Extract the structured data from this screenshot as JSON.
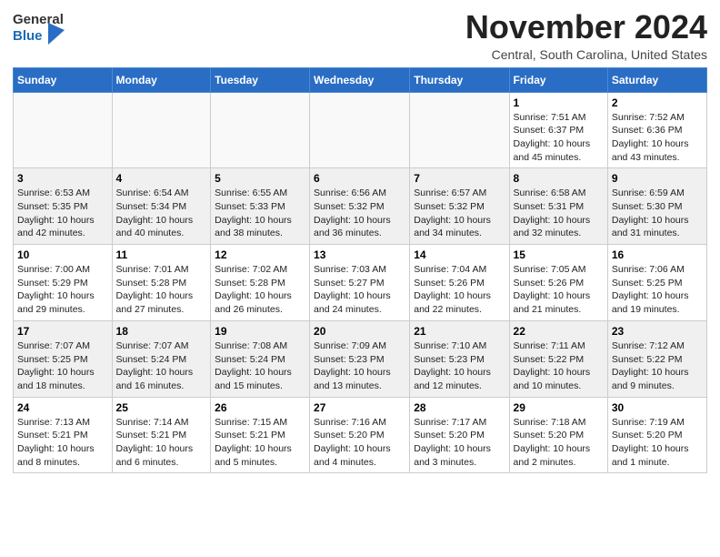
{
  "header": {
    "logo_general": "General",
    "logo_blue": "Blue",
    "month": "November 2024",
    "location": "Central, South Carolina, United States"
  },
  "calendar": {
    "days_of_week": [
      "Sunday",
      "Monday",
      "Tuesday",
      "Wednesday",
      "Thursday",
      "Friday",
      "Saturday"
    ],
    "weeks": [
      [
        {
          "day": "",
          "info": ""
        },
        {
          "day": "",
          "info": ""
        },
        {
          "day": "",
          "info": ""
        },
        {
          "day": "",
          "info": ""
        },
        {
          "day": "",
          "info": ""
        },
        {
          "day": "1",
          "info": "Sunrise: 7:51 AM\nSunset: 6:37 PM\nDaylight: 10 hours\nand 45 minutes."
        },
        {
          "day": "2",
          "info": "Sunrise: 7:52 AM\nSunset: 6:36 PM\nDaylight: 10 hours\nand 43 minutes."
        }
      ],
      [
        {
          "day": "3",
          "info": "Sunrise: 6:53 AM\nSunset: 5:35 PM\nDaylight: 10 hours\nand 42 minutes."
        },
        {
          "day": "4",
          "info": "Sunrise: 6:54 AM\nSunset: 5:34 PM\nDaylight: 10 hours\nand 40 minutes."
        },
        {
          "day": "5",
          "info": "Sunrise: 6:55 AM\nSunset: 5:33 PM\nDaylight: 10 hours\nand 38 minutes."
        },
        {
          "day": "6",
          "info": "Sunrise: 6:56 AM\nSunset: 5:32 PM\nDaylight: 10 hours\nand 36 minutes."
        },
        {
          "day": "7",
          "info": "Sunrise: 6:57 AM\nSunset: 5:32 PM\nDaylight: 10 hours\nand 34 minutes."
        },
        {
          "day": "8",
          "info": "Sunrise: 6:58 AM\nSunset: 5:31 PM\nDaylight: 10 hours\nand 32 minutes."
        },
        {
          "day": "9",
          "info": "Sunrise: 6:59 AM\nSunset: 5:30 PM\nDaylight: 10 hours\nand 31 minutes."
        }
      ],
      [
        {
          "day": "10",
          "info": "Sunrise: 7:00 AM\nSunset: 5:29 PM\nDaylight: 10 hours\nand 29 minutes."
        },
        {
          "day": "11",
          "info": "Sunrise: 7:01 AM\nSunset: 5:28 PM\nDaylight: 10 hours\nand 27 minutes."
        },
        {
          "day": "12",
          "info": "Sunrise: 7:02 AM\nSunset: 5:28 PM\nDaylight: 10 hours\nand 26 minutes."
        },
        {
          "day": "13",
          "info": "Sunrise: 7:03 AM\nSunset: 5:27 PM\nDaylight: 10 hours\nand 24 minutes."
        },
        {
          "day": "14",
          "info": "Sunrise: 7:04 AM\nSunset: 5:26 PM\nDaylight: 10 hours\nand 22 minutes."
        },
        {
          "day": "15",
          "info": "Sunrise: 7:05 AM\nSunset: 5:26 PM\nDaylight: 10 hours\nand 21 minutes."
        },
        {
          "day": "16",
          "info": "Sunrise: 7:06 AM\nSunset: 5:25 PM\nDaylight: 10 hours\nand 19 minutes."
        }
      ],
      [
        {
          "day": "17",
          "info": "Sunrise: 7:07 AM\nSunset: 5:25 PM\nDaylight: 10 hours\nand 18 minutes."
        },
        {
          "day": "18",
          "info": "Sunrise: 7:07 AM\nSunset: 5:24 PM\nDaylight: 10 hours\nand 16 minutes."
        },
        {
          "day": "19",
          "info": "Sunrise: 7:08 AM\nSunset: 5:24 PM\nDaylight: 10 hours\nand 15 minutes."
        },
        {
          "day": "20",
          "info": "Sunrise: 7:09 AM\nSunset: 5:23 PM\nDaylight: 10 hours\nand 13 minutes."
        },
        {
          "day": "21",
          "info": "Sunrise: 7:10 AM\nSunset: 5:23 PM\nDaylight: 10 hours\nand 12 minutes."
        },
        {
          "day": "22",
          "info": "Sunrise: 7:11 AM\nSunset: 5:22 PM\nDaylight: 10 hours\nand 10 minutes."
        },
        {
          "day": "23",
          "info": "Sunrise: 7:12 AM\nSunset: 5:22 PM\nDaylight: 10 hours\nand 9 minutes."
        }
      ],
      [
        {
          "day": "24",
          "info": "Sunrise: 7:13 AM\nSunset: 5:21 PM\nDaylight: 10 hours\nand 8 minutes."
        },
        {
          "day": "25",
          "info": "Sunrise: 7:14 AM\nSunset: 5:21 PM\nDaylight: 10 hours\nand 6 minutes."
        },
        {
          "day": "26",
          "info": "Sunrise: 7:15 AM\nSunset: 5:21 PM\nDaylight: 10 hours\nand 5 minutes."
        },
        {
          "day": "27",
          "info": "Sunrise: 7:16 AM\nSunset: 5:20 PM\nDaylight: 10 hours\nand 4 minutes."
        },
        {
          "day": "28",
          "info": "Sunrise: 7:17 AM\nSunset: 5:20 PM\nDaylight: 10 hours\nand 3 minutes."
        },
        {
          "day": "29",
          "info": "Sunrise: 7:18 AM\nSunset: 5:20 PM\nDaylight: 10 hours\nand 2 minutes."
        },
        {
          "day": "30",
          "info": "Sunrise: 7:19 AM\nSunset: 5:20 PM\nDaylight: 10 hours\nand 1 minute."
        }
      ]
    ]
  }
}
